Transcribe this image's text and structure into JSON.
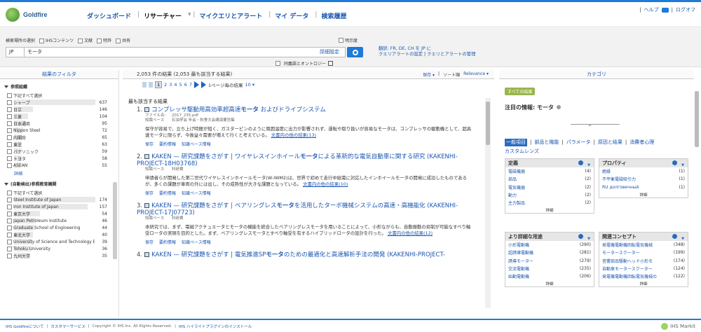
{
  "header": {
    "logo": "Goldfire",
    "nav": [
      {
        "label": "ダッシュボード"
      },
      {
        "label": "リサーチャー"
      },
      {
        "label": "マイクエリとアラート"
      },
      {
        "label": "マイ データ"
      },
      {
        "label": "検索履歴"
      }
    ],
    "help": "ヘルプ",
    "logout": "ログオフ"
  },
  "search": {
    "scope_label": "検索場所の選択",
    "scope": [
      "IHSコンテンツ",
      "文献",
      "特許",
      "共有"
    ],
    "related": "明示度",
    "lang": "JP",
    "query": "モータ",
    "advanced": "詳細設定",
    "synonyms": "同義語とオントロジー",
    "translate": "翻訳: FR, DE, CH を JP に",
    "query_settings": "クエリアラートの設定",
    "query_mgmt": "クエリとアラートの管理"
  },
  "left": {
    "header": "結果のフィルタ",
    "sections": [
      {
        "title": "参照組織",
        "select_all": "下記すべて選択",
        "items": [
          {
            "name": "シャープ",
            "count": "637",
            "pct": 0.95
          },
          {
            "name": "日立",
            "count": "146",
            "pct": 0.22
          },
          {
            "name": "三菱",
            "count": "104",
            "pct": 0.16
          },
          {
            "name": "日本通商",
            "count": "95",
            "pct": 0.14
          },
          {
            "name": "Nippon Steel",
            "count": "72",
            "pct": 0.11
          },
          {
            "name": "内閣府",
            "count": "65",
            "pct": 0.1
          },
          {
            "name": "東芝",
            "count": "63",
            "pct": 0.09
          },
          {
            "name": "パナソニック",
            "count": "59",
            "pct": 0.09
          },
          {
            "name": "トヨタ",
            "count": "58",
            "pct": 0.09
          },
          {
            "name": "ASEAN",
            "count": "55",
            "pct": 0.08
          }
        ],
        "detail": "詳細"
      },
      {
        "title": "(自動検出)参照教育機関",
        "select_all": "下記すべて選択",
        "items": [
          {
            "name": "Steel Institute of Japan",
            "count": "174",
            "pct": 0.95
          },
          {
            "name": "Iron Institute of Japan",
            "count": "157",
            "pct": 0.86
          },
          {
            "name": "東京大学",
            "count": "54",
            "pct": 0.3
          },
          {
            "name": "Japan Petroleum Institute",
            "count": "46",
            "pct": 0.25
          },
          {
            "name": "Graduate School of Engineering",
            "count": "44",
            "pct": 0.24
          },
          {
            "name": "東北大学",
            "count": "40",
            "pct": 0.22
          },
          {
            "name": "University of Science and Technology Beijing",
            "count": "39",
            "pct": 0.21
          },
          {
            "name": "Tohoku University",
            "count": "36",
            "pct": 0.2
          },
          {
            "name": "九州大学",
            "count": "35",
            "pct": 0.19
          }
        ]
      }
    ]
  },
  "center": {
    "count_text": "2,053 件の結果 (2,053 最も該当する結果)",
    "save": "保存",
    "sort": "ソート順",
    "sort_value": "Relevance",
    "pages": [
      "1",
      "2",
      "3",
      "4",
      "5",
      "6",
      "7"
    ],
    "per_page": "1ページ毎の結果",
    "per_page_value": "10",
    "best": "最も該当する結果",
    "results": [
      {
        "num": "1.",
        "pre": "コンプレッサ駆動用高効率超高速",
        "hl": "モータ",
        "post": " およびドライブシステム",
        "meta": [
          [
            "ファイル名:",
            "2017_235.pdf"
          ],
          [
            "知識ベース",
            "石油学会 年会・秋季大会講演要旨集"
          ]
        ],
        "snippet": "保守が容易で、立ち上げ時間が短く、ガスターピンのように周囲温度に出力が影響されず、運転や取り扱いが容易なモータは、コンプレッサの駆動機として、超高速モータに限らず、今後益々需要が増えて行くと考えている。",
        "more": "文書内の他の結果(13)",
        "actions": [
          "保存",
          "要約情報",
          "知識ベース情報"
        ]
      },
      {
        "num": "2.",
        "pre": "KAKEN — 研究課題をさがす | ワイヤレスインホイール",
        "hl": "モータ",
        "post": "による革新的な電気自動車に関する研究 (KAKENHI-PROJECT-18H03768)",
        "meta": [
          [
            "知識ベース",
            "科研費"
          ]
        ],
        "snippet": "申請者らが開発した第二世代ワイヤレスインホイールモータ(W-IWM2)は、世界で初めて走行中給電に対応したインホイールモータの開発に成功したものであるが、多くの課題が車両の外には出し、その成熟性が大きな課題となっている。",
        "more": "文書内の他の結果(10)",
        "actions": [
          "保存",
          "要約情報",
          "知識ベース情報"
        ]
      },
      {
        "num": "3.",
        "pre": "KAKEN — 研究課題をさがす | ベアリングレス",
        "hl": "モータ",
        "post": "を活用したターボ機械システムの高速・高機能化 (KAKENHI-PROJECT-17J07723)",
        "meta": [
          [
            "知識ベース",
            "科研費"
          ]
        ],
        "snippet": "本研究では、まず、電磁アクチュエータとモータの機能を統合したベアリングレスモータを用いることによって、小形ながらも、自動振動の抑制が可能なすべり軸受ロータの実現を目的とした。まず、ベアリングレスモータとすべり軸受を有するハイブリッドロータの設計を行った。",
        "more": "文書内の他の結果(12)",
        "actions": [
          "保存",
          "要約情報",
          "知識ベース情報"
        ]
      },
      {
        "num": "4.",
        "pre": "KAKEN — 研究課題をさがす | 電気推進SP",
        "hl": "モータ",
        "post": "のための最適化と高速解析手法の開発 (KAKENHI-PROJECT-",
        "meta": [],
        "snippet": "",
        "more": "",
        "actions": []
      }
    ]
  },
  "right": {
    "header": "カテゴリ",
    "all": "すべての結果",
    "focus_label": "注目の情報: モータ",
    "tabs": [
      "一般項目",
      "部品と機能",
      "パラメータ",
      "原因と結果",
      "消費者心理",
      "カスタムレンズ"
    ],
    "boxes": [
      {
        "title": "定義",
        "items": [
          [
            "電磁機器",
            "(4)"
          ],
          [
            "部品",
            "(2)"
          ],
          [
            "電気機器",
            "(2)"
          ],
          [
            "動力",
            "(2)"
          ],
          [
            "主力製品",
            "(2)"
          ]
        ],
        "detail": "詳細"
      },
      {
        "title": "プロパティ",
        "items": [
          [
            "絶縁",
            "(1)"
          ],
          [
            "不平衡電磁吸引力",
            "(1)"
          ],
          [
            "RU  долговечный",
            "(1)"
          ]
        ],
        "detail": "詳細"
      },
      {
        "title": "より詳細な用途",
        "items": [
          [
            "小形電動機",
            "(290)"
          ],
          [
            "超誘導電動機",
            "(281)"
          ],
          [
            "誘導モーター",
            "(279)"
          ],
          [
            "交流電動機",
            "(235)"
          ],
          [
            "始動電動機",
            "(206)"
          ]
        ],
        "detail": "詳細"
      },
      {
        "title": "関連コンセプト",
        "items": [
          [
            "発電機電動機回転電気機械",
            "(348)"
          ],
          [
            "モータースクーター",
            "(199)"
          ],
          [
            "音響部品駆動ヘッド小形モ",
            "(174)"
          ],
          [
            "自動車モータースクーター",
            "(124)"
          ],
          [
            "発電機電動機回転電気機械の",
            "(122)"
          ]
        ],
        "detail": "詳細"
      }
    ]
  },
  "footer": {
    "items": [
      "IHS Goldfireについて",
      "カスタマーサービス",
      "Copyright © IHS Inc. All Rights Reserved.",
      "IHS ハイライトプラグインのインストール"
    ],
    "brand": "IHS Markit"
  }
}
